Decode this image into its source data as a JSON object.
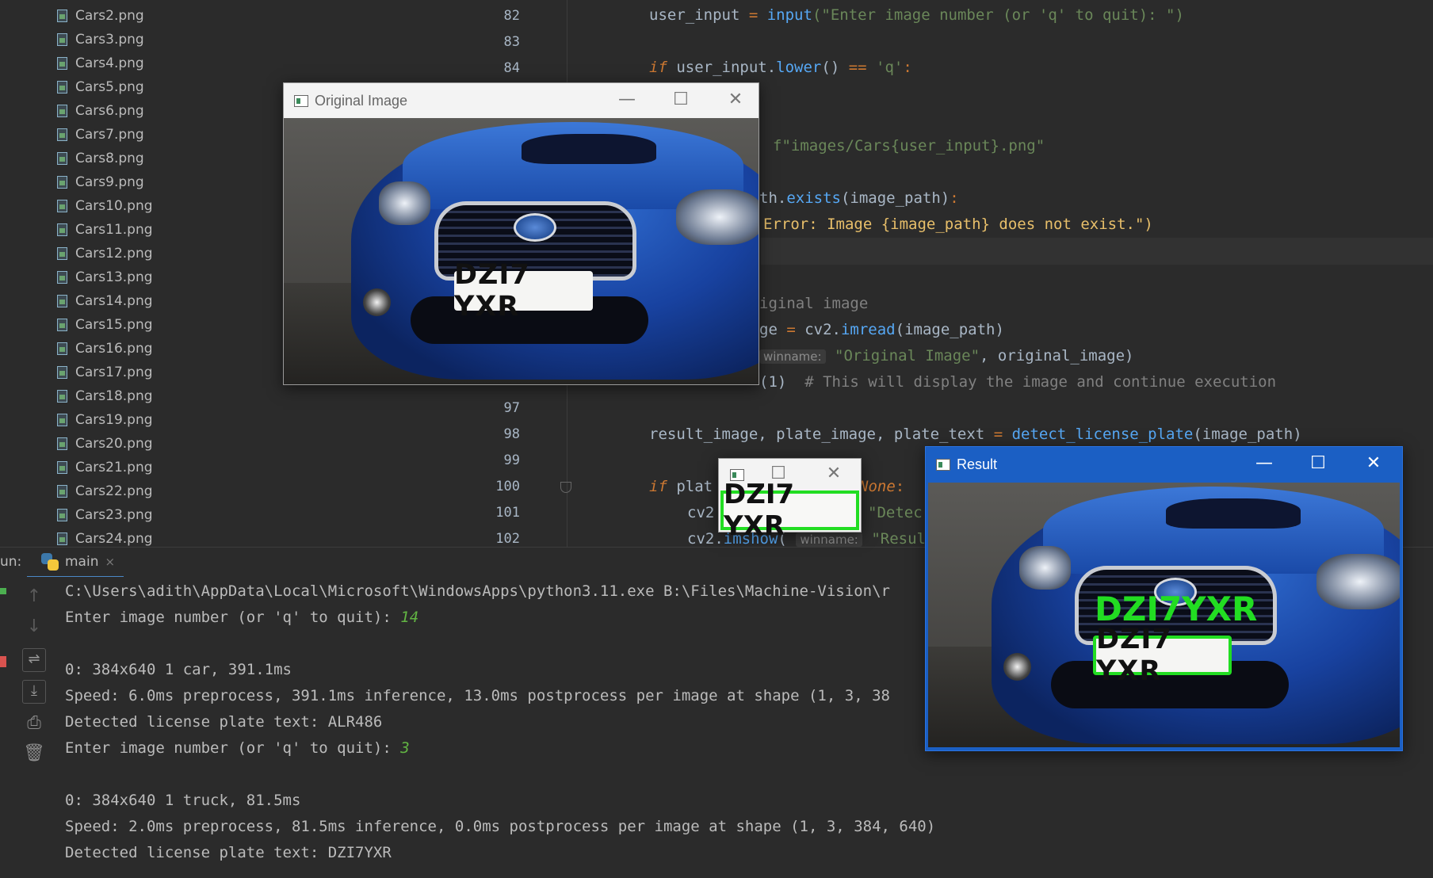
{
  "project_tree": {
    "files": [
      "Cars2.png",
      "Cars3.png",
      "Cars4.png",
      "Cars5.png",
      "Cars6.png",
      "Cars7.png",
      "Cars8.png",
      "Cars9.png",
      "Cars10.png",
      "Cars11.png",
      "Cars12.png",
      "Cars13.png",
      "Cars14.png",
      "Cars15.png",
      "Cars16.png",
      "Cars17.png",
      "Cars18.png",
      "Cars19.png",
      "Cars20.png",
      "Cars21.png",
      "Cars22.png",
      "Cars23.png",
      "Cars24.png"
    ]
  },
  "editor": {
    "line_numbers": [
      "82",
      "83",
      "84",
      "97",
      "98",
      "99",
      "100",
      "101",
      "102"
    ],
    "lines": {
      "l82_a": "user_input ",
      "l82_b": "= ",
      "l82_c": "input",
      "l82_d": "(\"Enter image number (or 'q' to quit): \")",
      "l84_a": "if ",
      "l84_b": "user_input.",
      "l84_c": "lower",
      "l84_d": "() ",
      "l84_e": "== ",
      "l84_f": "'q'",
      "l84_g": ":",
      "l87": "f\"images/Cars{user_input}.png\"",
      "l89_a": "th.",
      "l89_b": "exists",
      "l89_c": "(image_path)",
      "l89_d": ":",
      "l90_a": "Error: Image {image_path} does not exist.\")",
      "l93": "iginal image",
      "l94_a": "ge ",
      "l94_b": "= ",
      "l94_c": "cv2.",
      "l94_d": "imread",
      "l94_e": "(image_path)",
      "l95_hint": "winname:",
      "l95_a": "\"Original Image\"",
      "l95_b": ", original_image)",
      "l96_a": "(1)",
      "l96_b": "# This will display the image and continue execution",
      "l98_a": "result_image, plate_image, plate_text ",
      "l98_b": "= ",
      "l98_c": "detect_license_plate",
      "l98_d": "(image_path)",
      "l100_a": "if ",
      "l100_b": "plat",
      "l100_c": "None",
      "l100_d": ":",
      "l101_a": "cv2",
      "l101_b": "\"Detec",
      "l102_a": "cv2.",
      "l102_b": "imshow",
      "l102_c": "(",
      "l102_hint": "winname:",
      "l102_d": "\"Resul"
    }
  },
  "run_panel": {
    "label": "un:",
    "tab_name": "main",
    "tab_close": "×",
    "console_lines": [
      {
        "text": "C:\\Users\\adith\\AppData\\Local\\Microsoft\\WindowsApps\\python3.11.exe B:\\Files\\Machine-Vision\\r",
        "input": ""
      },
      {
        "text": "Enter image number (or 'q' to quit): ",
        "input": "14"
      },
      {
        "text": "",
        "input": ""
      },
      {
        "text": "0: 384x640 1 car, 391.1ms",
        "input": ""
      },
      {
        "text": "Speed: 6.0ms preprocess, 391.1ms inference, 13.0ms postprocess per image at shape (1, 3, 38",
        "input": ""
      },
      {
        "text": "Detected license plate text: ALR486",
        "input": ""
      },
      {
        "text": "Enter image number (or 'q' to quit): ",
        "input": "3"
      },
      {
        "text": "",
        "input": ""
      },
      {
        "text": "0: 384x640 1 truck, 81.5ms",
        "input": ""
      },
      {
        "text": "Speed: 2.0ms preprocess, 81.5ms inference, 0.0ms postprocess per image at shape (1, 3, 384, 640)",
        "input": ""
      },
      {
        "text": "Detected license plate text: DZI7YXR",
        "input": ""
      }
    ]
  },
  "windows": {
    "original": {
      "title": "Original Image",
      "plate_text": "DZI7 YXR"
    },
    "plate": {
      "plate_text": "DZI7 YXR"
    },
    "result": {
      "title": "Result",
      "plate_text": "DZI7 YXR",
      "detected_text": "DZI7YXR"
    }
  },
  "window_buttons": {
    "minimize": "—",
    "maximize": "☐",
    "close": "✕"
  },
  "colors": {
    "result_titlebar": "#1b5fc4",
    "detection_box": "#22dd22",
    "console_input": "#62b543"
  }
}
